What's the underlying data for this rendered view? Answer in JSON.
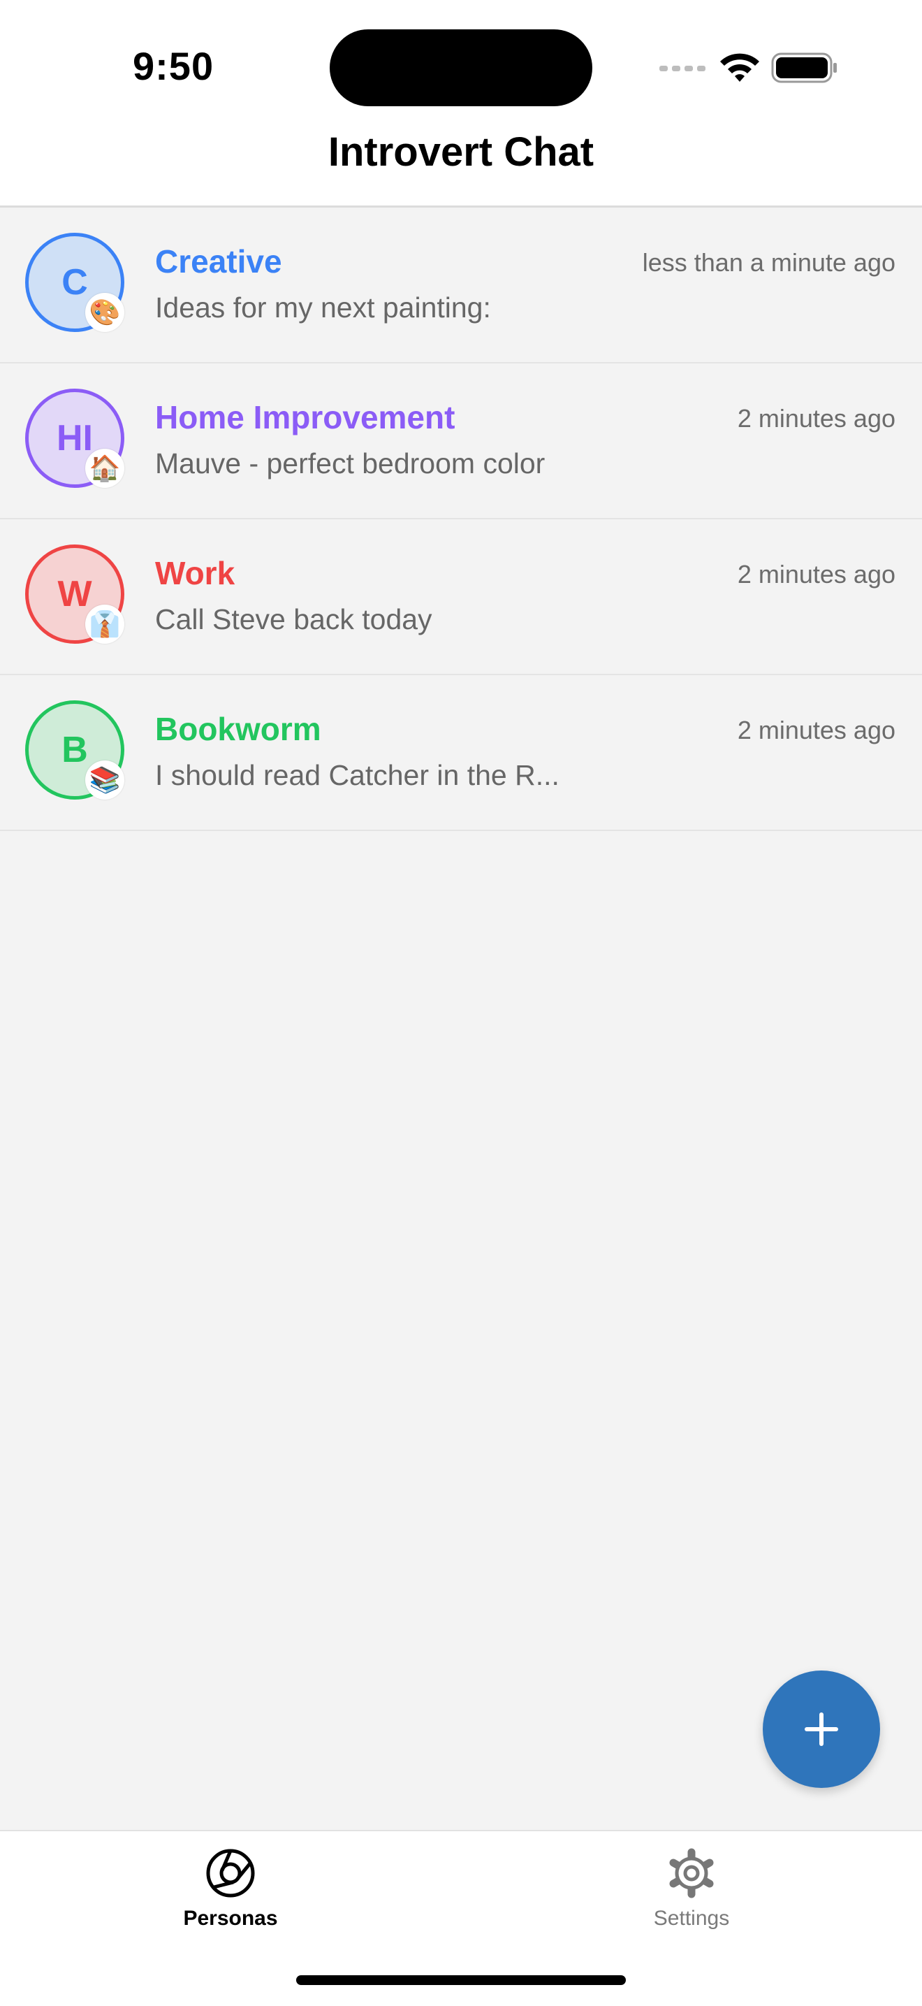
{
  "status_bar": {
    "time": "9:50"
  },
  "header": {
    "title": "Introvert Chat"
  },
  "personas": [
    {
      "initials": "C",
      "name": "Creative",
      "time": "less than a minute ago",
      "preview": "Ideas for my next painting:",
      "emoji": "🎨",
      "color": "#3b82f6",
      "bg": "#cfe0f6"
    },
    {
      "initials": "HI",
      "name": "Home Improvement",
      "time": "2 minutes ago",
      "preview": "Mauve - perfect bedroom color",
      "emoji": "🏠",
      "color": "#8b5cf6",
      "bg": "#e2d8f8"
    },
    {
      "initials": "W",
      "name": "Work",
      "time": "2 minutes ago",
      "preview": "Call Steve back today",
      "emoji": "👔",
      "color": "#ef4444",
      "bg": "#f6d2d2"
    },
    {
      "initials": "B",
      "name": "Bookworm",
      "time": "2 minutes ago",
      "preview": "I should read Catcher in the R...",
      "emoji": "📚",
      "color": "#22c55e",
      "bg": "#cfecd8"
    }
  ],
  "fab": {
    "icon": "plus-icon",
    "color": "#2f75bb"
  },
  "tabs": [
    {
      "label": "Personas",
      "icon": "aperture-icon",
      "active": true
    },
    {
      "label": "Settings",
      "icon": "gear-icon",
      "active": false
    }
  ]
}
